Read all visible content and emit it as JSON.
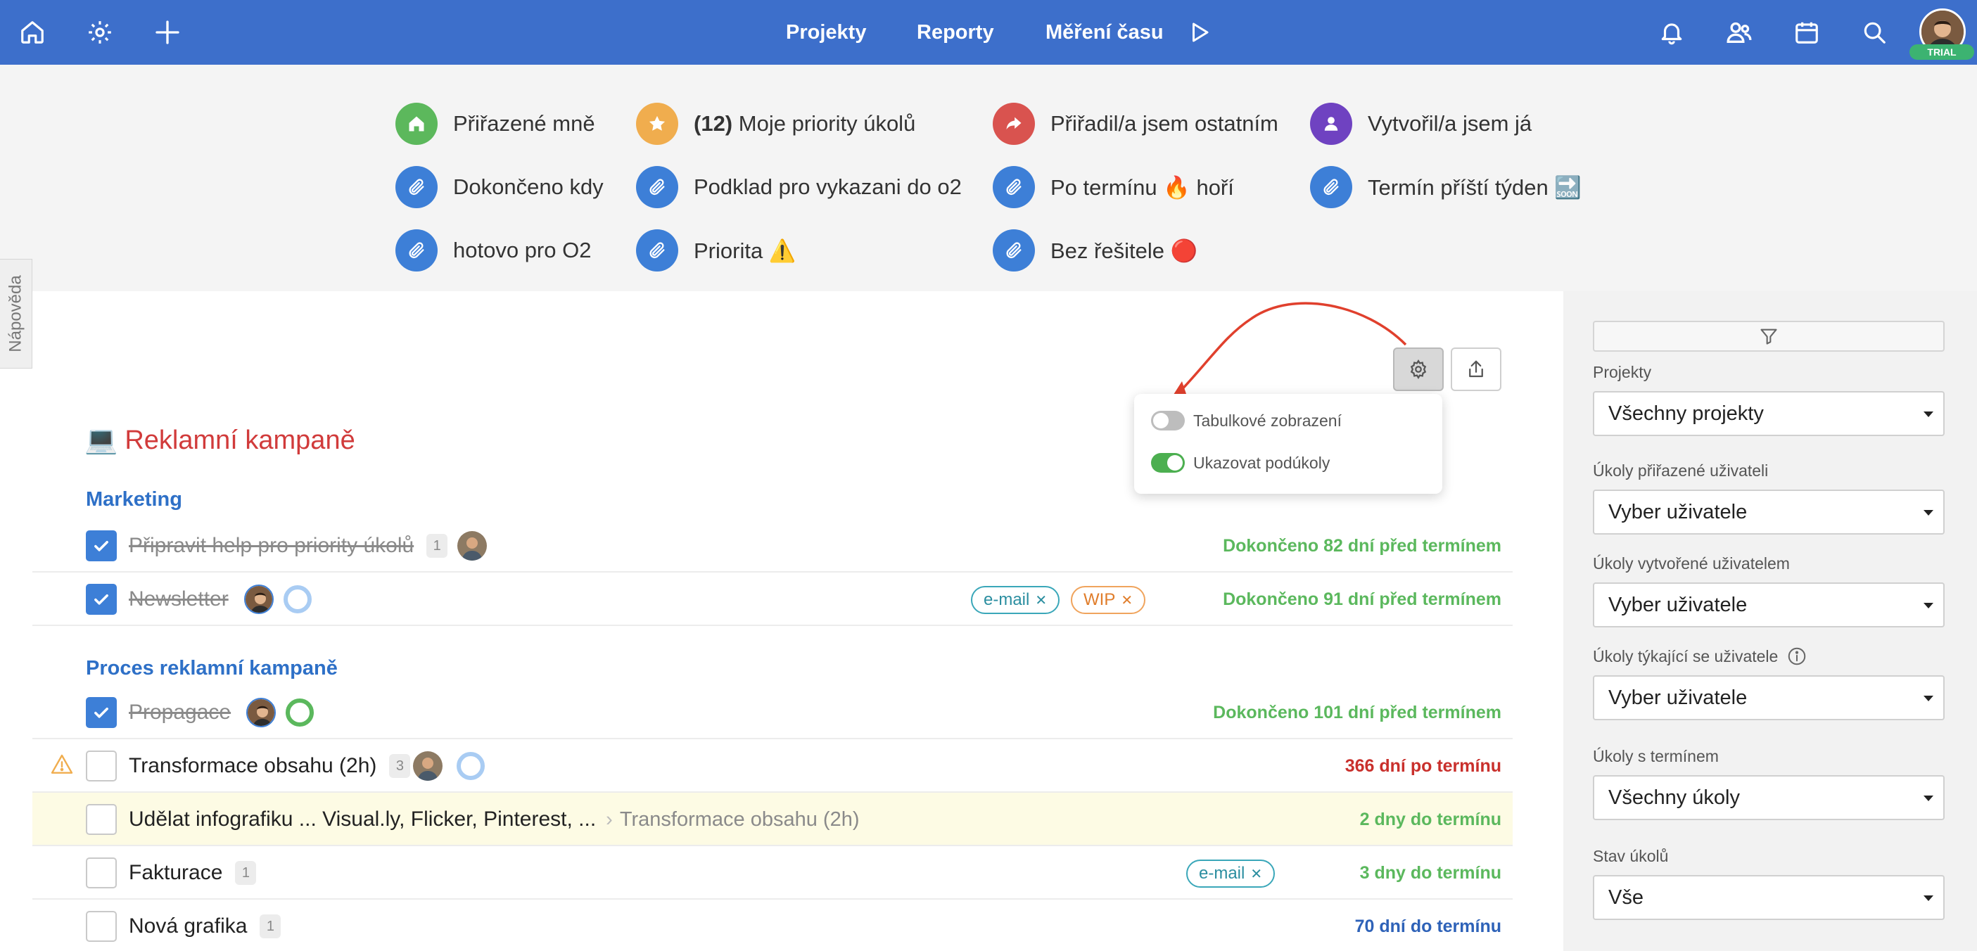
{
  "topbar": {
    "nav": [
      "Projekty",
      "Reporty",
      "Měření času"
    ],
    "trial_badge": "TRIAL",
    "icons": [
      "home-icon",
      "settings-icon",
      "plus-icon",
      "play-icon",
      "bell-icon",
      "users-icon",
      "calendar-icon",
      "search-icon"
    ],
    "color": "#3d6fcb"
  },
  "filters": [
    {
      "label": "Přiřazené mně",
      "icon": "home-icon",
      "color": "#5cb85c"
    },
    {
      "prefix": "(12)",
      "label": "Moje priority úkolů",
      "icon": "star-icon",
      "color": "#f0ad4e"
    },
    {
      "label": "Přiřadil/a jsem ostatním",
      "icon": "share-icon",
      "color": "#d9534f"
    },
    {
      "label": "Vytvořil/a jsem já",
      "icon": "user-icon",
      "color": "#6f42c1"
    },
    {
      "label": "Dokončeno kdy",
      "icon": "paperclip-icon",
      "color": "#3d7fd7"
    },
    {
      "label": "Podklad pro vykazani do o2",
      "icon": "paperclip-icon",
      "color": "#3d7fd7"
    },
    {
      "label": "Po termínu 🔥 hoří",
      "icon": "paperclip-icon",
      "color": "#3d7fd7"
    },
    {
      "label": "Termín příští týden 🔜",
      "icon": "paperclip-icon",
      "color": "#3d7fd7"
    },
    {
      "label": "hotovo pro O2",
      "icon": "paperclip-icon",
      "color": "#3d7fd7"
    },
    {
      "label": "Priorita ⚠️",
      "icon": "paperclip-icon",
      "color": "#3d7fd7"
    },
    {
      "label": "Bez řešitele 🔴",
      "icon": "paperclip-icon",
      "color": "#3d7fd7"
    }
  ],
  "help_tab": "Nápověda",
  "view_options": [
    {
      "label": "Tabulkové zobrazení",
      "on": false
    },
    {
      "label": "Ukazovat podúkoly",
      "on": true
    }
  ],
  "project": {
    "emoji": "💻",
    "title": "Reklamní kampaně"
  },
  "sections": [
    "Marketing",
    "Proces reklamní kampaně"
  ],
  "tasks": [
    {
      "name": "Připravit help pro priority úkolů",
      "done": true,
      "count": "1",
      "status": "Dokončeno 82 dní před termínem",
      "tone": "green"
    },
    {
      "name": "Newsletter",
      "done": true,
      "tags": [
        "e-mail",
        "WIP"
      ],
      "status": "Dokončeno 91 dní před termínem",
      "tone": "green"
    },
    {
      "name": "Propagace",
      "done": true,
      "status": "Dokončeno 101 dní před termínem",
      "tone": "green"
    },
    {
      "name": "Transformace obsahu (2h)",
      "done": false,
      "count": "3",
      "warning": true,
      "status": "366 dní po termínu",
      "tone": "red"
    },
    {
      "name": "Udělat infografiku ... Visual.ly, Flicker, Pinterest, ...",
      "done": false,
      "parent": "Transformace obsahu (2h)",
      "status": "2 dny do termínu",
      "tone": "green"
    },
    {
      "name": "Fakturace",
      "done": false,
      "count": "1",
      "tags": [
        "e-mail"
      ],
      "status": "3 dny do termínu",
      "tone": "green"
    },
    {
      "name": "Nová grafika",
      "done": false,
      "count": "1",
      "status": "70 dní do termínu",
      "tone": "blue"
    }
  ],
  "sidebar": {
    "fields": [
      {
        "label": "Projekty",
        "value": "Všechny projekty"
      },
      {
        "label": "Úkoly přiřazené uživateli",
        "value": "Vyber uživatele"
      },
      {
        "label": "Úkoly vytvořené uživatelem",
        "value": "Vyber uživatele"
      },
      {
        "label": "Úkoly týkající se uživatele",
        "value": "Vyber uživatele",
        "info": true
      },
      {
        "label": "Úkoly s termínem",
        "value": "Všechny úkoly"
      },
      {
        "label": "Stav úkolů",
        "value": "Vše"
      }
    ]
  }
}
